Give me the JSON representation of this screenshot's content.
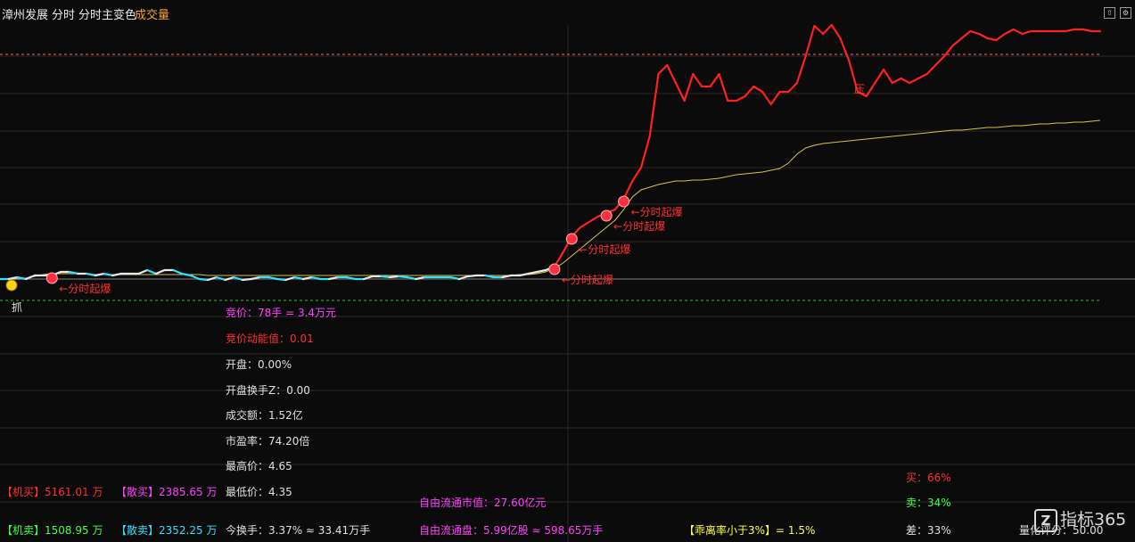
{
  "header": {
    "stock_name": "漳州发展",
    "mode_label": "分时",
    "indicator_label": "分时主变色",
    "volume_label": "成交量"
  },
  "colors": {
    "up": "#ff2020",
    "down": "#30e0ff",
    "flat": "#e8e8e8",
    "avg_line": "#d7c24a",
    "signal_text": "#ff3030",
    "magenta": "#ff40ff",
    "green": "#40ff40"
  },
  "chart_annotations": {
    "burst_label": "←分时起爆",
    "grab_label": "抓",
    "pressure_label": "压"
  },
  "stats": {
    "auction_price": "竞价：78手 = 3.4万元",
    "auction_momentum": "竞价动能值：0.01",
    "open": "开盘：0.00%",
    "open_turnover": "开盘换手Z：0.00",
    "turnover_amount": "成交额：1.52亿",
    "pe_ratio": "市盈率：74.20倍",
    "high_price": "最高价：4.65",
    "low_price": "最低价：4.35",
    "today_turnover": "今换手：3.37% ≈ 33.41万手",
    "free_float_mv": "自由流通市值：27.60亿元",
    "free_float_shares": "自由流通盘：5.99亿股 ≈ 598.65万手"
  },
  "flows": {
    "inst_buy": "【机买】5161.01 万",
    "retail_buy": "【散买】2385.65 万",
    "inst_sell": "【机卖】1508.95 万",
    "retail_sell": "【散卖】2352.25 万"
  },
  "sentiment": {
    "buy": "买：66%",
    "sell": "卖：34%",
    "diff": "差：33%",
    "deviation": "【乖离率小于3%】= 1.5%",
    "quant_score": "量化评分：50.00"
  },
  "logo": {
    "mark": "Z",
    "text": "指标365"
  },
  "chart_data": {
    "type": "line",
    "y_relative": [
      0,
      0,
      2,
      0,
      4,
      4,
      4,
      8,
      8,
      6,
      6,
      4,
      6,
      4,
      6,
      6,
      6,
      10,
      6,
      10,
      10,
      6,
      4,
      0,
      -1,
      2,
      -1,
      2,
      -1,
      0,
      2,
      2,
      0,
      -1,
      2,
      0,
      2,
      0,
      0,
      2,
      2,
      0,
      0,
      3,
      3,
      2,
      3,
      2,
      0,
      2,
      2,
      2,
      2,
      0,
      3,
      4,
      4,
      2,
      2,
      4,
      4,
      6,
      8,
      10,
      14,
      30,
      48,
      58,
      64,
      70,
      74,
      78,
      90,
      110,
      125,
      160,
      230,
      240,
      220,
      200,
      230,
      216,
      216,
      230,
      200,
      200,
      205,
      216,
      210,
      196,
      210,
      210,
      220,
      250,
      284,
      275,
      285,
      270,
      245,
      210,
      205,
      220,
      235,
      220,
      225,
      220,
      225,
      230,
      240,
      250,
      262,
      270,
      278,
      275,
      270,
      268,
      275,
      280,
      275,
      278,
      278,
      278,
      278,
      278,
      280,
      280,
      278,
      278
    ],
    "avg_relative": [
      0,
      0,
      0,
      1,
      3,
      5,
      6,
      6,
      6,
      6,
      6,
      5,
      5,
      5,
      5,
      5,
      5,
      5,
      5,
      5,
      5,
      5,
      5,
      5,
      4,
      4,
      4,
      4,
      4,
      4,
      4,
      4,
      4,
      4,
      4,
      4,
      4,
      4,
      4,
      4,
      4,
      4,
      4,
      4,
      4,
      4,
      4,
      4,
      4,
      4,
      4,
      4,
      4,
      4,
      4,
      4,
      4,
      4,
      4,
      4,
      5,
      5,
      6,
      8,
      12,
      18,
      26,
      34,
      42,
      50,
      58,
      66,
      78,
      92,
      100,
      103,
      106,
      108,
      110,
      110,
      111,
      111,
      112,
      113,
      115,
      117,
      118,
      119,
      120,
      122,
      124,
      130,
      140,
      147,
      150,
      152,
      153,
      154,
      155,
      156,
      157,
      158,
      159,
      160,
      161,
      162,
      163,
      164,
      165,
      166,
      167,
      167,
      168,
      169,
      170,
      170,
      171,
      172,
      172,
      173,
      174,
      174,
      175,
      175,
      176,
      176,
      177,
      178
    ],
    "signals": [
      {
        "type": "burst",
        "index": 6
      },
      {
        "type": "burst",
        "index": 64
      },
      {
        "type": "burst",
        "index": 66
      },
      {
        "type": "burst",
        "index": 70
      },
      {
        "type": "burst",
        "index": 72
      }
    ],
    "reference_lines": [
      "prev_close",
      "pressure_top",
      "support_bottom"
    ]
  }
}
